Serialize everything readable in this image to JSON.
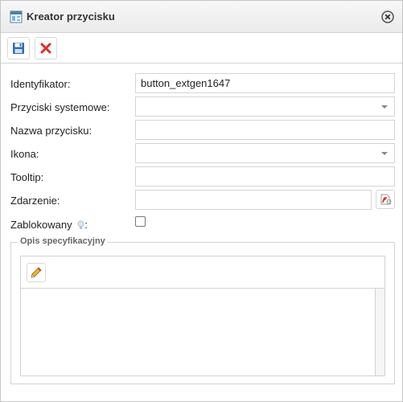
{
  "window": {
    "title": "Kreator przycisku"
  },
  "icons": {
    "window": "window-icon",
    "close": "close-circle-icon",
    "save": "floppy-disk-icon",
    "delete": "red-x-icon",
    "event": "event-script-icon",
    "hint": "lightbulb-icon",
    "edit": "pencil-icon"
  },
  "form": {
    "identifier_label": "Identyfikator:",
    "identifier_value": "button_extgen1647",
    "system_buttons_label": "Przyciski systemowe:",
    "system_buttons_value": "",
    "button_name_label": "Nazwa przycisku:",
    "button_name_value": "",
    "icon_label": "Ikona:",
    "icon_value": "",
    "tooltip_label": "Tooltip:",
    "tooltip_value": "",
    "event_label": "Zdarzenie:",
    "event_value": "",
    "blocked_label": "Zablokowany",
    "blocked_suffix": ":",
    "blocked_checked": false
  },
  "spec": {
    "legend": "Opis specyfikacyjny",
    "content": ""
  },
  "colors": {
    "save_blue": "#2f6db5",
    "delete_red": "#d9302c",
    "pencil_yellow": "#f0b429"
  }
}
